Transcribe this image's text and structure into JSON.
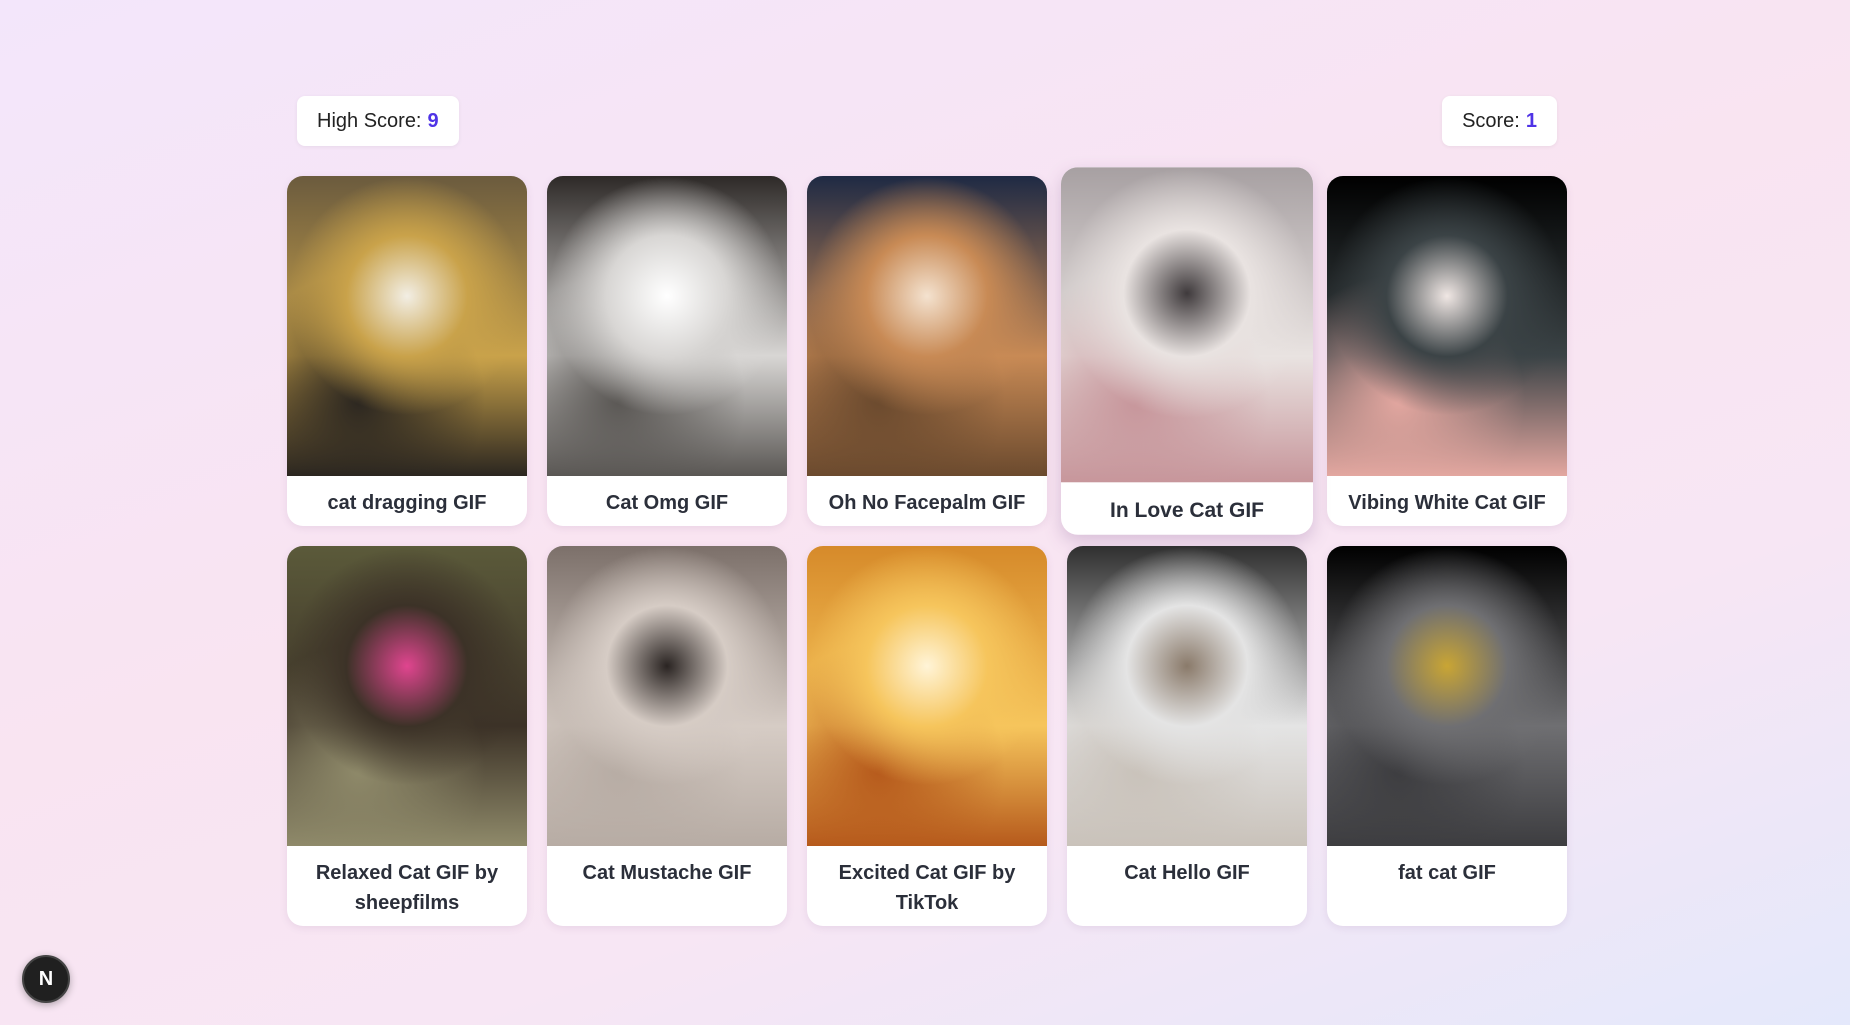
{
  "high_score": {
    "label": "High Score:",
    "value": "9"
  },
  "score": {
    "label": "Score:",
    "value": "1"
  },
  "cards": [
    {
      "title": "cat dragging GIF",
      "icon": "cat-dragging-image",
      "colors": [
        "#6b5b3e",
        "#c9a24a",
        "#f2eee4",
        "#2b2620"
      ]
    },
    {
      "title": "Cat Omg GIF",
      "icon": "cat-omg-image",
      "colors": [
        "#2e2a28",
        "#d8d6d4",
        "#ffffff",
        "#5a5754"
      ]
    },
    {
      "title": "Oh No Facepalm GIF",
      "icon": "cat-facepalm-image",
      "colors": [
        "#1f2a44",
        "#c88a55",
        "#f4e2cf",
        "#6b4a2e"
      ]
    },
    {
      "title": "In Love Cat GIF",
      "icon": "cat-in-love-image",
      "colors": [
        "#a7a0a2",
        "#e9e3e1",
        "#3f3a3c",
        "#c7969b"
      ]
    },
    {
      "title": "Vibing White Cat GIF",
      "icon": "cat-vibing-image",
      "colors": [
        "#000000",
        "#3b4346",
        "#f0e7e4",
        "#e3a7a0"
      ]
    },
    {
      "title": "Relaxed Cat GIF by sheepfilms",
      "icon": "cat-relaxed-image",
      "colors": [
        "#5b5a3a",
        "#3c3227",
        "#e0458f",
        "#8f8a6a"
      ]
    },
    {
      "title": "Cat Mustache GIF",
      "icon": "cat-mustache-image",
      "colors": [
        "#7c706a",
        "#d6ccc5",
        "#2a2422",
        "#b7aca4"
      ]
    },
    {
      "title": "Excited Cat GIF by TikTok",
      "icon": "cat-excited-image",
      "colors": [
        "#d68a2a",
        "#f6c55c",
        "#fff4d7",
        "#b65a1c"
      ]
    },
    {
      "title": "Cat Hello GIF",
      "icon": "cat-hello-image",
      "colors": [
        "#2f2f2f",
        "#e4e4e4",
        "#8a7a6a",
        "#c9c2ba"
      ]
    },
    {
      "title": "fat cat GIF",
      "icon": "cat-fat-image",
      "colors": [
        "#000000",
        "#6f6f72",
        "#c9a534",
        "#3d3d40"
      ]
    }
  ],
  "hovered_index": 3,
  "next_badge": {
    "label": "N",
    "icon": "nextjs-icon"
  }
}
